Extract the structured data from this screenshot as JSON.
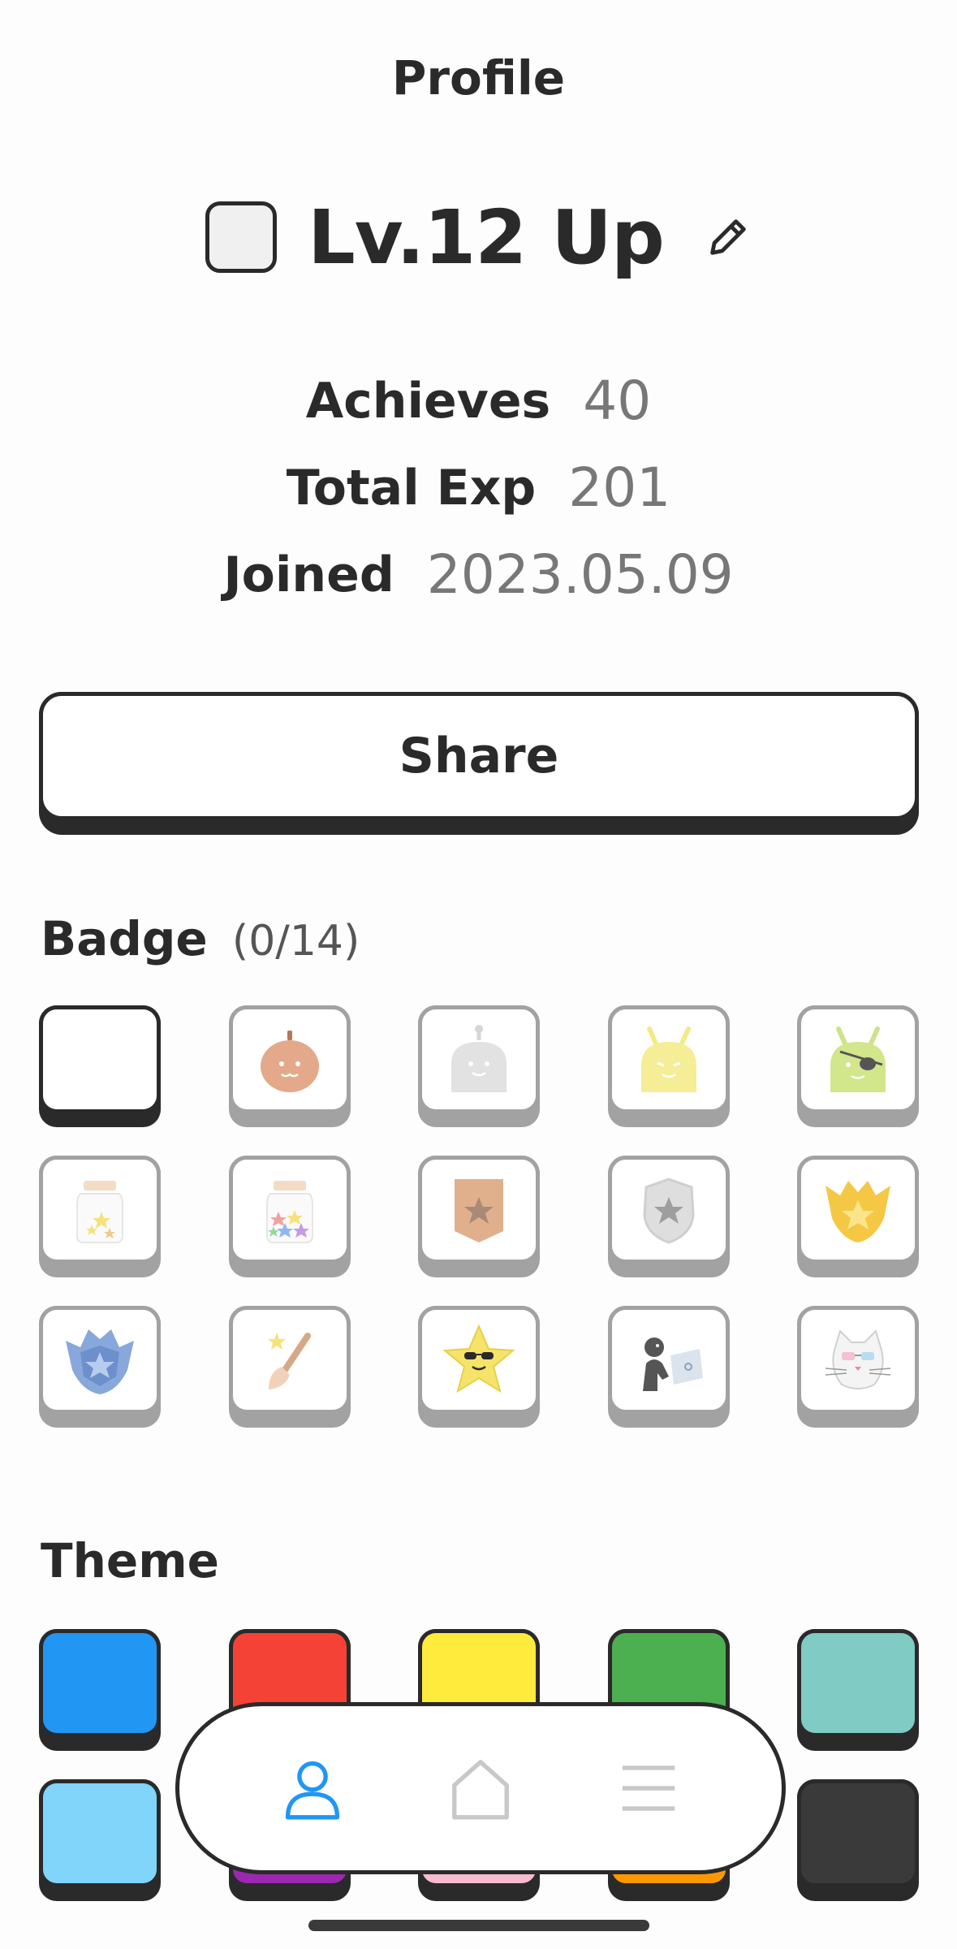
{
  "header": {
    "title": "Profile"
  },
  "profile": {
    "name": "Lv.12 Up",
    "stats": [
      {
        "label": "Achieves",
        "value": "40"
      },
      {
        "label": "Total Exp",
        "value": "201"
      },
      {
        "label": "Joined",
        "value": "2023.05.09"
      }
    ],
    "share_label": "Share"
  },
  "badges": {
    "title": "Badge",
    "count": "(0/14)",
    "items": [
      {
        "icon": "empty-slot"
      },
      {
        "icon": "pumpkin-icon"
      },
      {
        "icon": "robot-icon"
      },
      {
        "icon": "yellow-android-icon"
      },
      {
        "icon": "pirate-android-icon"
      },
      {
        "icon": "star-jar-small-icon"
      },
      {
        "icon": "star-jar-full-icon"
      },
      {
        "icon": "bronze-pennant-icon"
      },
      {
        "icon": "silver-shield-icon"
      },
      {
        "icon": "gold-crest-icon"
      },
      {
        "icon": "blue-crest-icon"
      },
      {
        "icon": "paintbrush-icon"
      },
      {
        "icon": "cool-star-icon"
      },
      {
        "icon": "hacker-icon"
      },
      {
        "icon": "cool-cat-icon"
      }
    ]
  },
  "theme": {
    "title": "Theme",
    "colors": [
      "#2196F3",
      "#F44336",
      "#FFEB3B",
      "#4CAF50",
      "#80CBC4",
      "#81D4FA",
      "#9C27B0",
      "#F8BBD0",
      "#FF9800",
      "#3A3A3A"
    ]
  },
  "nav": {
    "items": [
      {
        "icon": "person-icon",
        "active": true,
        "color": "#2196F3"
      },
      {
        "icon": "home-icon",
        "active": false,
        "color": "#C8C8C8"
      },
      {
        "icon": "menu-icon",
        "active": false,
        "color": "#C8C8C8"
      }
    ]
  }
}
